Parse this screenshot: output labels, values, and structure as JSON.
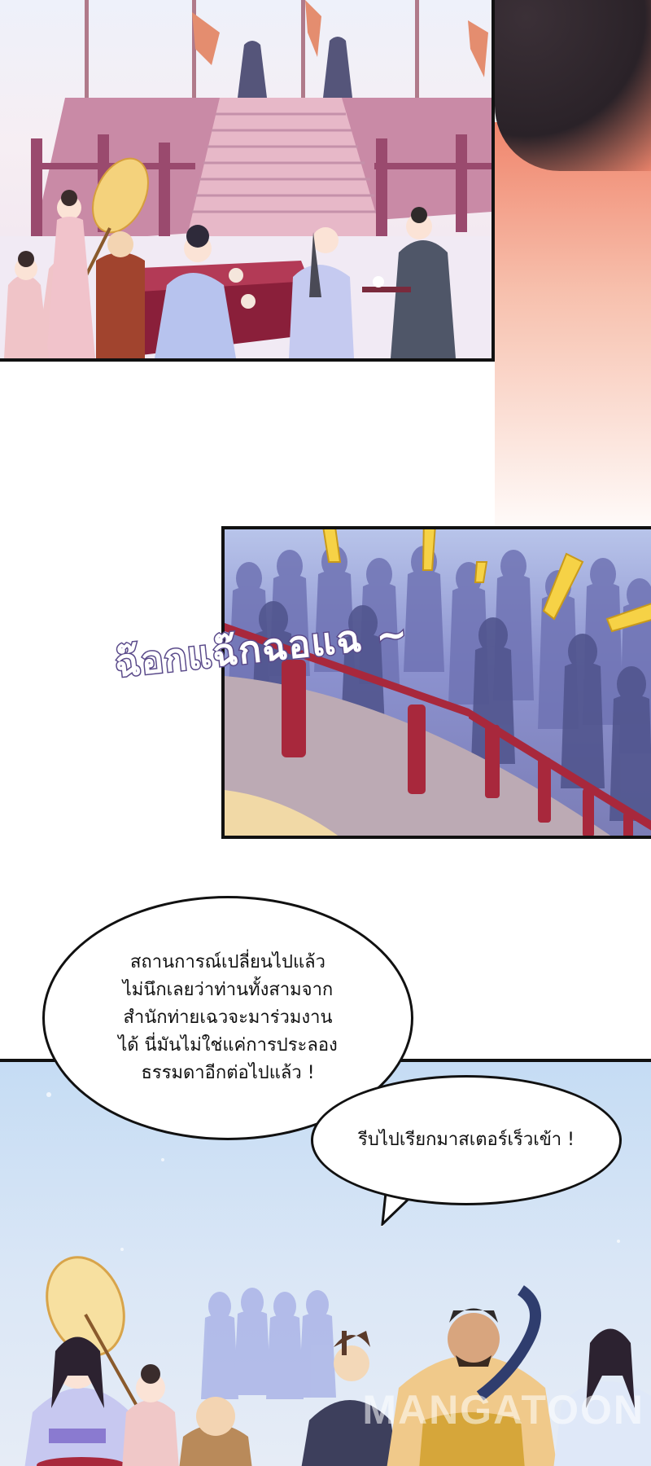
{
  "sfx": {
    "text": "ฉ๊อกแฉ๊กฉอแฉ ~"
  },
  "bubbles": {
    "speech1_lines": [
      "สถานการณ์เปลี่ยนไปแล้ว",
      "ไม่นึกเลยว่าท่านทั้งสามจาก",
      "สำนักท่ายเฉวจะมาร่วมงาน",
      "ได้ นี่มันไม่ใช่แค่การประลอง",
      "ธรรมดาอีกต่อไปแล้ว !"
    ],
    "speech2": "รีบไปเรียกมาสเตอร์เร็วเข้า !"
  },
  "watermark": "MANGATOON",
  "colors": {
    "panel_border": "#111111",
    "sfx_outline": "#5a4a8a",
    "crowd_blue": "#6f73b4",
    "fence_red": "#a8283c"
  }
}
